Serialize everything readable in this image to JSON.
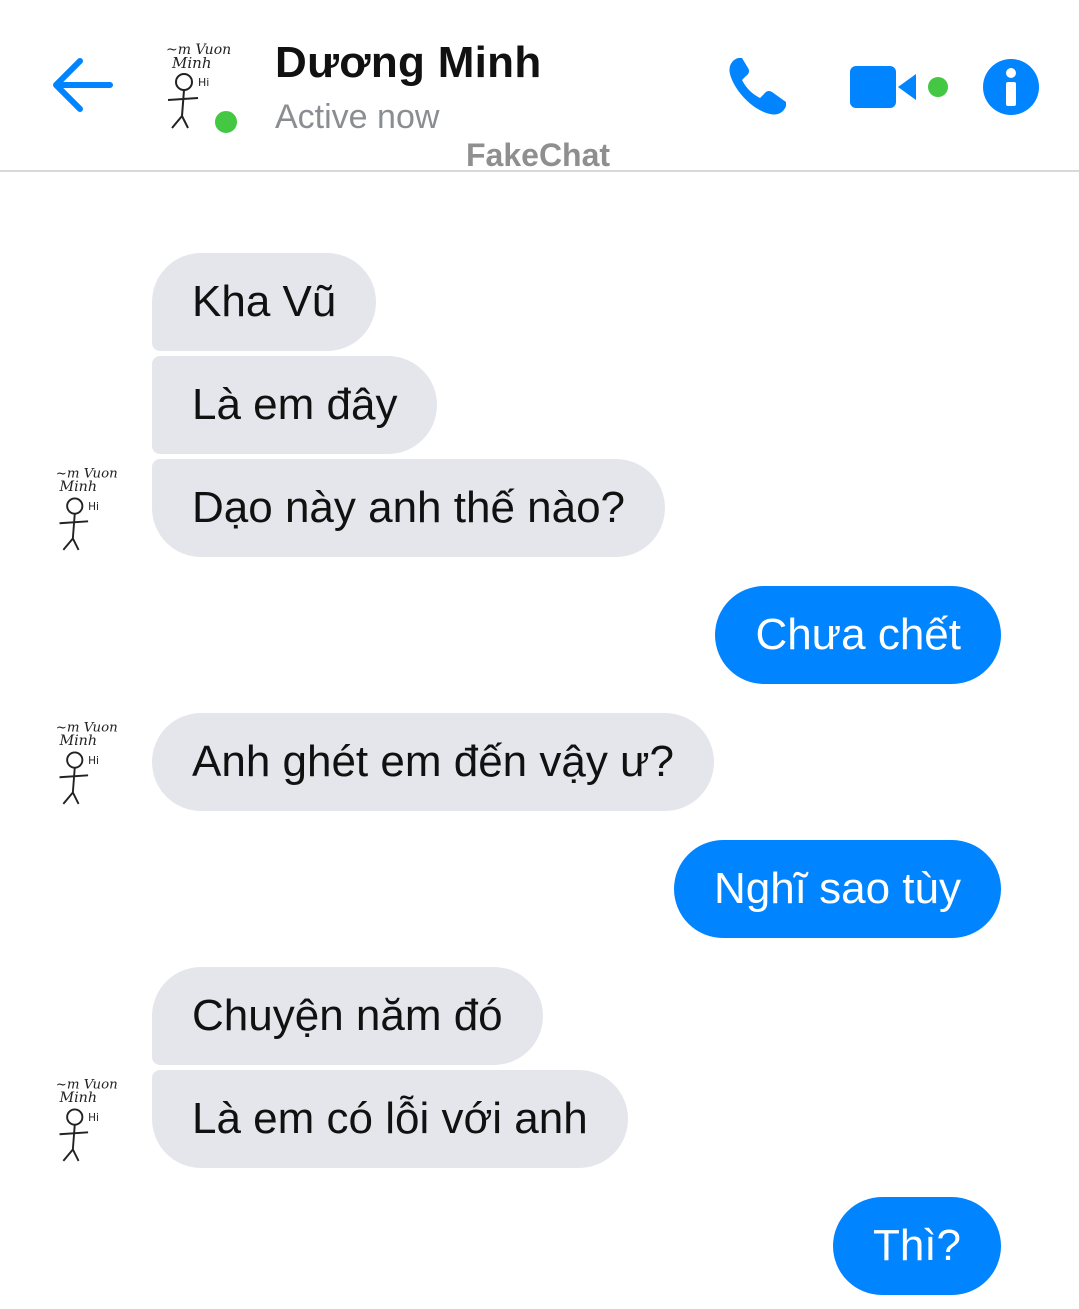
{
  "header": {
    "contact_name": "Dương Minh",
    "status": "Active now",
    "watermark": "FakeChat",
    "online_color": "#44c742",
    "accent_color": "#0084ff",
    "icons": [
      "back-arrow-icon",
      "phone-icon",
      "video-camera-icon",
      "info-icon"
    ]
  },
  "avatar_text": {
    "top": "~m Vuon",
    "name": "Minh",
    "greeting": "Hi"
  },
  "messages": [
    {
      "from": "them",
      "text": "Kha Vũ"
    },
    {
      "from": "them",
      "text": "Là em đây"
    },
    {
      "from": "them",
      "text": "Dạo này anh thế nào?"
    },
    {
      "from": "me",
      "text": "Chưa chết"
    },
    {
      "from": "them",
      "text": "Anh ghét em đến vậy ư?"
    },
    {
      "from": "me",
      "text": "Nghĩ sao tùy"
    },
    {
      "from": "them",
      "text": "Chuyện năm đó"
    },
    {
      "from": "them",
      "text": "Là em có lỗi với anh"
    },
    {
      "from": "me",
      "text": "Thì?"
    }
  ],
  "colors": {
    "incoming_bubble": "#e4e6eb",
    "outgoing_bubble": "#0084ff"
  }
}
